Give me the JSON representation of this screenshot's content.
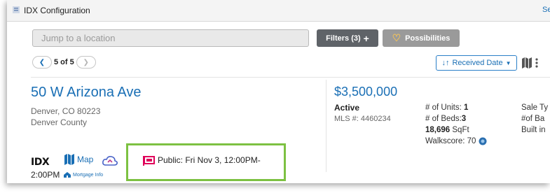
{
  "window": {
    "title": "IDX Configuration",
    "right_link": "Se"
  },
  "toolbar": {
    "search_placeholder": "Jump to a location",
    "filters_label": "Filters (3)",
    "possibilities_label": "Possibilities"
  },
  "pager": {
    "count": "5 of 5",
    "prev_icon": "chevron-left-icon",
    "next_icon": "chevron-right-icon"
  },
  "sort": {
    "label": "Received Date"
  },
  "listing": {
    "address": "50 W Arizona Ave",
    "city_line": "Denver, CO 80223",
    "county": "Denver County",
    "price": "$3,500,000",
    "status": "Active",
    "mls_label": "MLS #:",
    "mls_number": "4460234",
    "details": {
      "units_label": "# of Units:",
      "units_value": "1",
      "beds_label": "# of Beds:",
      "beds_value": "3",
      "sqft_value": "18,696",
      "sqft_label": "SqFt",
      "walkscore_label": "Walkscore:",
      "walkscore_value": "70"
    },
    "sale_col": {
      "line1": "Sale Ty",
      "line2": "#of Ba",
      "line3": "Built in"
    }
  },
  "footer": {
    "idx_logo": "IDX",
    "map_label": "Map",
    "open_house": "Public: Fri Nov 3, 12:00PM-",
    "open_house_end": "2:00PM",
    "mortgage_label": "Mortgage Info"
  },
  "colors": {
    "accent": "#1a6fb5",
    "highlight": "#7dc142",
    "open_house_icon": "#e0005a"
  }
}
